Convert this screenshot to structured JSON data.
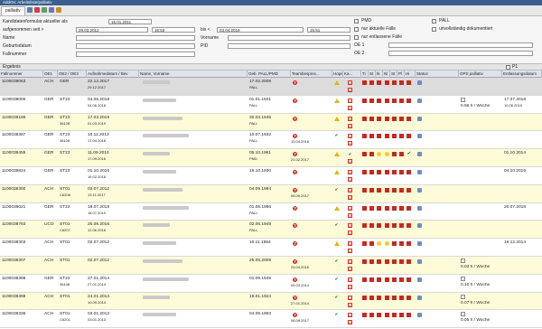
{
  "window": {
    "title": "AddOn: Arbeitsliste/palliativ"
  },
  "tabs": [
    {
      "label": "palliativ"
    }
  ],
  "form": {
    "kandidaten_label": "Kandidatenformular aktueller als",
    "kandidaten_value": "15.01.2011",
    "aufgenommen_label": "aufgenommen seit >",
    "aufgenommen_date": "29.03.2012",
    "aufgenommen_time": "16:53",
    "bis_label": "bis <",
    "bis_date": "03.04.2019",
    "bis_time": "15:51",
    "name_label": "Name",
    "vorname_label": "Vorname",
    "geburtsdatum_label": "Geburtsdatum",
    "pid_label": "PID",
    "fallnummer_label": "Fallnummer",
    "pmd_label": "PMD",
    "pall_label": "PALL",
    "nur_aktuelle_label": "nur aktuelle Fälle",
    "unvollstaendig_label": "unvollständig dokumentiert",
    "nur_entlassene_label": "nur entlassene Fälle",
    "oe1_label": "OE 1",
    "oe2_label": "OE 2"
  },
  "section": {
    "title": "Ergebnis",
    "p1_label": "P1"
  },
  "columns": [
    "Fallnummer",
    "OE1",
    "OE2 / OE3",
    "Aufnahmedatum / Bev",
    "Name, Vorname",
    "Geb. PALL/PMD",
    "Teambesprec...",
    "Hope",
    "Ka...",
    "Ti",
    "St",
    "Ik",
    "Ni",
    "St",
    "Pl",
    "Hi",
    "Status",
    "OPS palliativ",
    "Entlassungsdatum"
  ],
  "rows": [
    {
      "fall": "1100039063",
      "oe1": "ACH",
      "oe2": "GER",
      "oe3": "",
      "aufn": "22.12.2017",
      "aufn2": "29.12.2017",
      "geb": "17.02.2009",
      "geb2": "PALL",
      "team_date": "",
      "ops": "",
      "entl": "",
      "style": "sel",
      "hope": "warn",
      "ka": "x",
      "ind": [
        "red",
        "red",
        "red",
        "red",
        "red",
        "red",
        "red"
      ],
      "status": "edit"
    },
    {
      "fall": "1100039006",
      "oe1": "GER",
      "oe2": "ST23",
      "oe3": "",
      "aufn": "04.06.2018",
      "aufn2": "04.06.2018",
      "geb": "01.01.1941",
      "geb2": "PALL",
      "team_date": "",
      "ops": "0.56 h / Woche",
      "entl": "17.07.2018",
      "entl2": "10.06.2019",
      "style": "white",
      "hope": "warn",
      "ka": "x",
      "ind": [
        "red",
        "red",
        "red",
        "red",
        "red",
        "red",
        "red"
      ],
      "status": "edit"
    },
    {
      "fall": "1100039186",
      "oe1": "GER",
      "oe2": "ST23",
      "oe3": "36108",
      "aufn": "17.03.2019",
      "aufn2": "01.03.2019",
      "geb": "30.03.1945",
      "geb2": "PALL",
      "team_date": "",
      "ops": "",
      "entl": "",
      "style": "yellow",
      "hope": "warn",
      "ka": "x",
      "ind": [
        "red",
        "red",
        "red",
        "red",
        "red",
        "red",
        "red"
      ],
      "status": "edit"
    },
    {
      "fall": "1100038387",
      "oe1": "GER",
      "oe2": "ST23",
      "oe3": "36108",
      "aufn": "10.11.2013",
      "aufn2": "17.04.2018",
      "geb": "10.07.1932",
      "geb2": "PALL",
      "team_date": "15.04.2016",
      "ops": "",
      "entl": "",
      "style": "white",
      "hope": "ok",
      "ka": "x",
      "ind": [
        "red",
        "red",
        "red",
        "red",
        "red",
        "red",
        "red"
      ],
      "status": "edit"
    },
    {
      "fall": "1100038455",
      "oe1": "GER",
      "oe2": "ST23",
      "oe3": "",
      "aufn": "11.09.2014",
      "aufn2": "17.09.2016",
      "geb": "05.10.1961",
      "geb2": "PMD",
      "team_date": "21.02.2017",
      "ops": "",
      "entl": "01.10.2014",
      "style": "yellow",
      "hope": "warn",
      "ka": "ok",
      "ind": [
        "red",
        "red",
        "circ",
        "circ",
        "red",
        "red",
        "ck"
      ],
      "status": "edit"
    },
    {
      "fall": "1100038824",
      "oe1": "GER",
      "oe2": "ST23",
      "oe3": "",
      "aufn": "01.10.2016",
      "aufn2": "16.02.2018",
      "geb": "16.10.1930",
      "geb2": "",
      "team_date": "",
      "ops": "",
      "entl": "04.10.2016",
      "style": "white",
      "hope": "warn",
      "ka": "x",
      "ind": [
        "red",
        "red",
        "red",
        "red",
        "red",
        "red",
        "red"
      ],
      "status": "edit"
    },
    {
      "fall": "1100038300",
      "oe1": "ACH",
      "oe2": "ST01",
      "oe3": "C6208",
      "aufn": "02.07.2012",
      "aufn2": "13.11.2017",
      "geb": "04.09.1984",
      "geb2": "",
      "team_date": "08.09.2017",
      "ops": "",
      "entl": "",
      "style": "yellow",
      "hope": "ok",
      "ka": "x",
      "ind": [
        "red",
        "red",
        "red",
        "red",
        "red",
        "red",
        "red"
      ],
      "status": "edit"
    },
    {
      "fall": "1100039021",
      "oe1": "GER",
      "oe2": "ST23",
      "oe3": "",
      "aufn": "18.07.2018",
      "aufn2": "18.07.2019",
      "geb": "01.05.1956",
      "geb2": "PALL",
      "team_date": "",
      "ops": "",
      "entl": "20.07.2018",
      "style": "white",
      "hope": "warn",
      "ka": "x",
      "ind": [
        "red",
        "red",
        "red",
        "red",
        "red",
        "red",
        "red"
      ],
      "status": "edit"
    },
    {
      "fall": "1100038783",
      "oe1": "UCO",
      "oe2": "ST01",
      "oe3": "C6207",
      "aufn": "25.06.2016",
      "aufn2": "12.06.2016",
      "geb": "02.06.1949",
      "geb2": "PALL",
      "team_date": "",
      "ops": "",
      "entl": "",
      "style": "yellow",
      "hope": "ok",
      "ka": "x",
      "ind": [
        "red",
        "red",
        "red",
        "red",
        "red",
        "red",
        "red"
      ],
      "status": "edit"
    },
    {
      "fall": "1100038303",
      "oe1": "ACH",
      "oe2": "ST01",
      "oe3": "",
      "aufn": "02.07.2012",
      "aufn2": "",
      "geb": "10.11.1964",
      "geb2": "",
      "team_date": "",
      "ops": "",
      "entl": "16.12.2014",
      "style": "white",
      "hope": "warn",
      "ka": "x",
      "ind": [
        "red",
        "red",
        "circ",
        "circ",
        "red",
        "red",
        "red"
      ],
      "status": "edit"
    },
    {
      "fall": "1100038307",
      "oe1": "ACH",
      "oe2": "ST01",
      "oe3": "",
      "aufn": "02.07.2012",
      "aufn2": "",
      "geb": "25.05.2009",
      "geb2": "",
      "team_date": "25.04.2016",
      "ops": "0.02 h / Woche",
      "entl": "",
      "style": "yellow",
      "hope": "ok",
      "ka": "x",
      "ind": [
        "red",
        "red",
        "red",
        "red",
        "red",
        "red",
        "red"
      ],
      "status": "edit"
    },
    {
      "fall": "1100038398",
      "oe1": "GER",
      "oe2": "ST23",
      "oe3": "36108",
      "aufn": "27.01.2014",
      "aufn2": "27.01.2014",
      "geb": "01.09.1945",
      "geb2": "",
      "team_date": "05.03.2014",
      "ops": "0.10 h / Woche",
      "entl": "",
      "style": "white",
      "hope": "ok",
      "ka": "x",
      "ind": [
        "red",
        "red",
        "red",
        "red",
        "red",
        "red",
        "red"
      ],
      "status": "edit"
    },
    {
      "fall": "1100038398",
      "oe1": "ACH",
      "oe2": "ST01",
      "oe3": "",
      "aufn": "24.01.2014",
      "aufn2": "10.09.2014",
      "geb": "19.01.1924",
      "geb2": "",
      "team_date": "27.01.2014",
      "ops": "0.07 h / Woche",
      "entl": "",
      "style": "yellow",
      "hope": "ok",
      "ka": "x",
      "ind": [
        "red",
        "red",
        "red",
        "red",
        "red",
        "red",
        "red"
      ],
      "status": "edit"
    },
    {
      "fall": "1100038336",
      "oe1": "ACH",
      "oe2": "ST01",
      "oe3": "C6201",
      "aufn": "03.01.2013",
      "aufn2": "03.01.2013",
      "geb": "04.09.1983",
      "geb2": "",
      "team_date": "08.09.2017",
      "ops": "0.05 h / Woche",
      "entl": "",
      "style": "white",
      "hope": "ok",
      "ka": "x",
      "ind": [
        "red",
        "red",
        "red",
        "red",
        "red",
        "red",
        "red"
      ],
      "status": "edit"
    }
  ]
}
